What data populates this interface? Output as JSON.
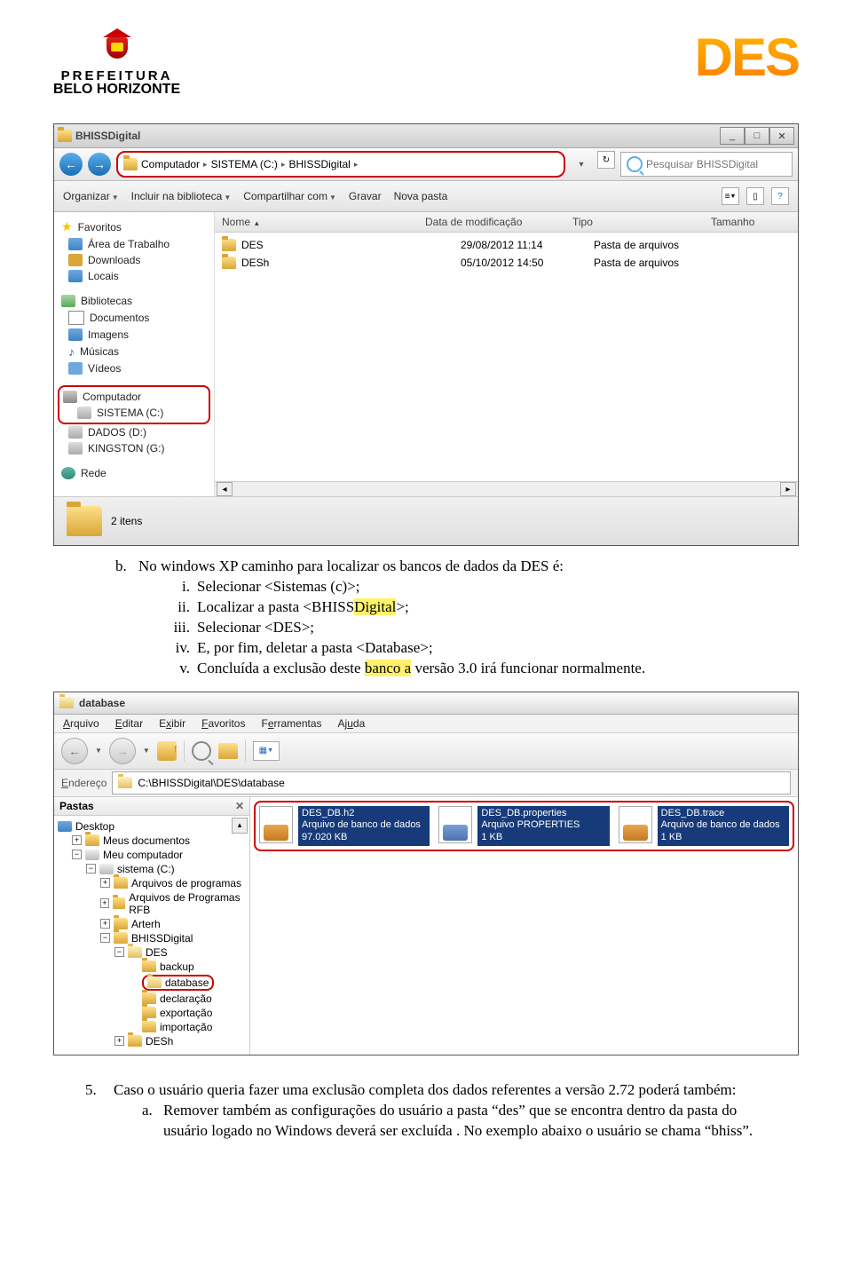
{
  "header": {
    "prefeitura": "PREFEITURA",
    "belo": "BELO HORIZONTE",
    "des_logo": "DES"
  },
  "screenshot1": {
    "title": "BHISSDigital",
    "breadcrumb": [
      "Computador",
      "SISTEMA (C:)",
      "BHISSDigital"
    ],
    "refresh_glyph": "↻",
    "search_placeholder": "Pesquisar BHISSDigital",
    "toolbar": [
      "Organizar",
      "Incluir na biblioteca",
      "Compartilhar com",
      "Gravar",
      "Nova pasta"
    ],
    "columns": {
      "name": "Nome",
      "date": "Data de modificação",
      "type": "Tipo",
      "size": "Tamanho"
    },
    "sidebar": {
      "favoritos": {
        "label": "Favoritos",
        "items": [
          "Área de Trabalho",
          "Downloads",
          "Locais"
        ]
      },
      "bibliotecas": {
        "label": "Bibliotecas",
        "items": [
          "Documentos",
          "Imagens",
          "Músicas",
          "Vídeos"
        ]
      },
      "computador": {
        "label": "Computador",
        "drives": [
          "SISTEMA (C:)",
          "DADOS (D:)",
          "KINGSTON (G:)"
        ]
      },
      "rede": "Rede"
    },
    "files": [
      {
        "name": "DES",
        "date": "29/08/2012 11:14",
        "type": "Pasta de arquivos"
      },
      {
        "name": "DESh",
        "date": "05/10/2012 14:50",
        "type": "Pasta de arquivos"
      }
    ],
    "status_count": "2 itens"
  },
  "text_b": {
    "heading": "No windows XP caminho para localizar os bancos de dados da DES é:",
    "items": [
      {
        "n": "i.",
        "t": "Selecionar <Sistemas (c)>;"
      },
      {
        "n": "ii.",
        "t": "Localizar a pasta <BHISSDigital>;"
      },
      {
        "n": "iii.",
        "t": "Selecionar <DES>;"
      },
      {
        "n": "iv.",
        "t": "E, por fim, deletar a pasta <Database>;"
      },
      {
        "n": "v.",
        "t": "Concluída a exclusão deste banco a versão 3.0 irá funcionar normalmente."
      }
    ]
  },
  "screenshot2": {
    "title": "database",
    "menu": [
      "Arquivo",
      "Editar",
      "Exibir",
      "Favoritos",
      "Ferramentas",
      "Ajuda"
    ],
    "address_label": "Endereço",
    "address_path": "C:\\BHISSDigital\\DES\\database",
    "tree_header": "Pastas",
    "tree": {
      "desktop": "Desktop",
      "meus_docs": "Meus documentos",
      "meu_comp": "Meu computador",
      "cdrive": "sistema (C:)",
      "folders1": [
        "Arquivos de programas",
        "Arquivos de Programas RFB",
        "Arterh"
      ],
      "bhiss": "BHISSDigital",
      "des": "DES",
      "des_sub": [
        "backup",
        "database",
        "declaração",
        "exportação",
        "importação"
      ],
      "desh": "DESh"
    },
    "tiles": [
      {
        "name": "DES_DB.h2",
        "l2": "Arquivo de banco de dados",
        "l3": "97.020 KB"
      },
      {
        "name": "DES_DB.properties",
        "l2": "Arquivo PROPERTIES",
        "l3": "1 KB"
      },
      {
        "name": "DES_DB.trace",
        "l2": "Arquivo de banco de dados",
        "l3": "1 KB"
      }
    ]
  },
  "text_5": {
    "num": "5.",
    "body": "Caso o usuário queria fazer uma exclusão completa dos dados referentes a versão 2.72 poderá também:",
    "a_letter": "a.",
    "a_body": "Remover também as configurações do usuário a pasta “des” que se encontra dentro da pasta do usuário logado no Windows deverá ser excluída . No exemplo abaixo o usuário se chama “bhiss”."
  }
}
